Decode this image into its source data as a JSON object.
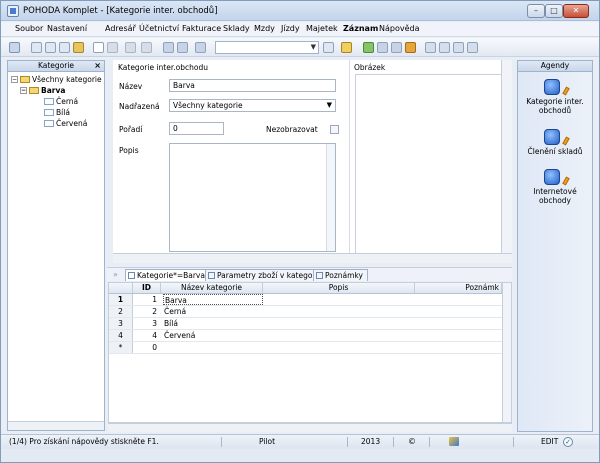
{
  "window": {
    "title": "POHODA Komplet - [Kategorie inter. obchodů]",
    "controls": {
      "minimize": "–",
      "maximize": "□",
      "close": "✕"
    }
  },
  "menu": [
    "Soubor",
    "Nastavení",
    "Adresář",
    "Účetnictví",
    "Fakturace",
    "Sklady",
    "Mzdy",
    "Jízdy",
    "Majetek",
    "Záznam",
    "Nápověda"
  ],
  "left_panel": {
    "title": "Kategorie",
    "close": "×",
    "tree": [
      {
        "label": "Všechny kategorie",
        "level": 0,
        "expander": "−"
      },
      {
        "label": "Barva",
        "level": 1,
        "expander": "−",
        "bold": true
      },
      {
        "label": "Černá",
        "level": 2
      },
      {
        "label": "Bílá",
        "level": 2
      },
      {
        "label": "Červená",
        "level": 2
      }
    ]
  },
  "form": {
    "title": "Kategorie inter.obchodu",
    "name_label": "Název",
    "name_value": "Barva",
    "parent_label": "Nadřazená",
    "parent_value": "Všechny kategorie",
    "order_label": "Pořadí",
    "order_value": "0",
    "notshow_label": "Nezobrazovat",
    "desc_label": "Popis",
    "picture_label": "Obrázek"
  },
  "tabs": [
    {
      "label": "Kategorie*=Barva",
      "active": true
    },
    {
      "label": "Parametry zboží v kategorii",
      "active": false
    },
    {
      "label": "Poznámky",
      "active": false
    }
  ],
  "grid": {
    "columns": [
      "ID",
      "Název kategorie",
      "Popis",
      "Poznámk"
    ],
    "rows": [
      {
        "row": "1",
        "id": "1",
        "name": "Barva"
      },
      {
        "row": "2",
        "id": "2",
        "name": "Černá"
      },
      {
        "row": "3",
        "id": "3",
        "name": "Bílá"
      },
      {
        "row": "4",
        "id": "4",
        "name": "Červená"
      },
      {
        "row": "*",
        "id": "0",
        "name": ""
      }
    ]
  },
  "agenda": {
    "title": "Agendy",
    "items": [
      "Kategorie inter. obchodů",
      "Členění skladů",
      "Internetové obchody"
    ]
  },
  "status": {
    "help": "(1/4) Pro získání nápovědy stiskněte F1.",
    "user": "Pilot",
    "year": "2013",
    "mode": "EDIT"
  },
  "colors": {
    "accent": "#2661c9",
    "window_bg": "#e9eef6"
  }
}
